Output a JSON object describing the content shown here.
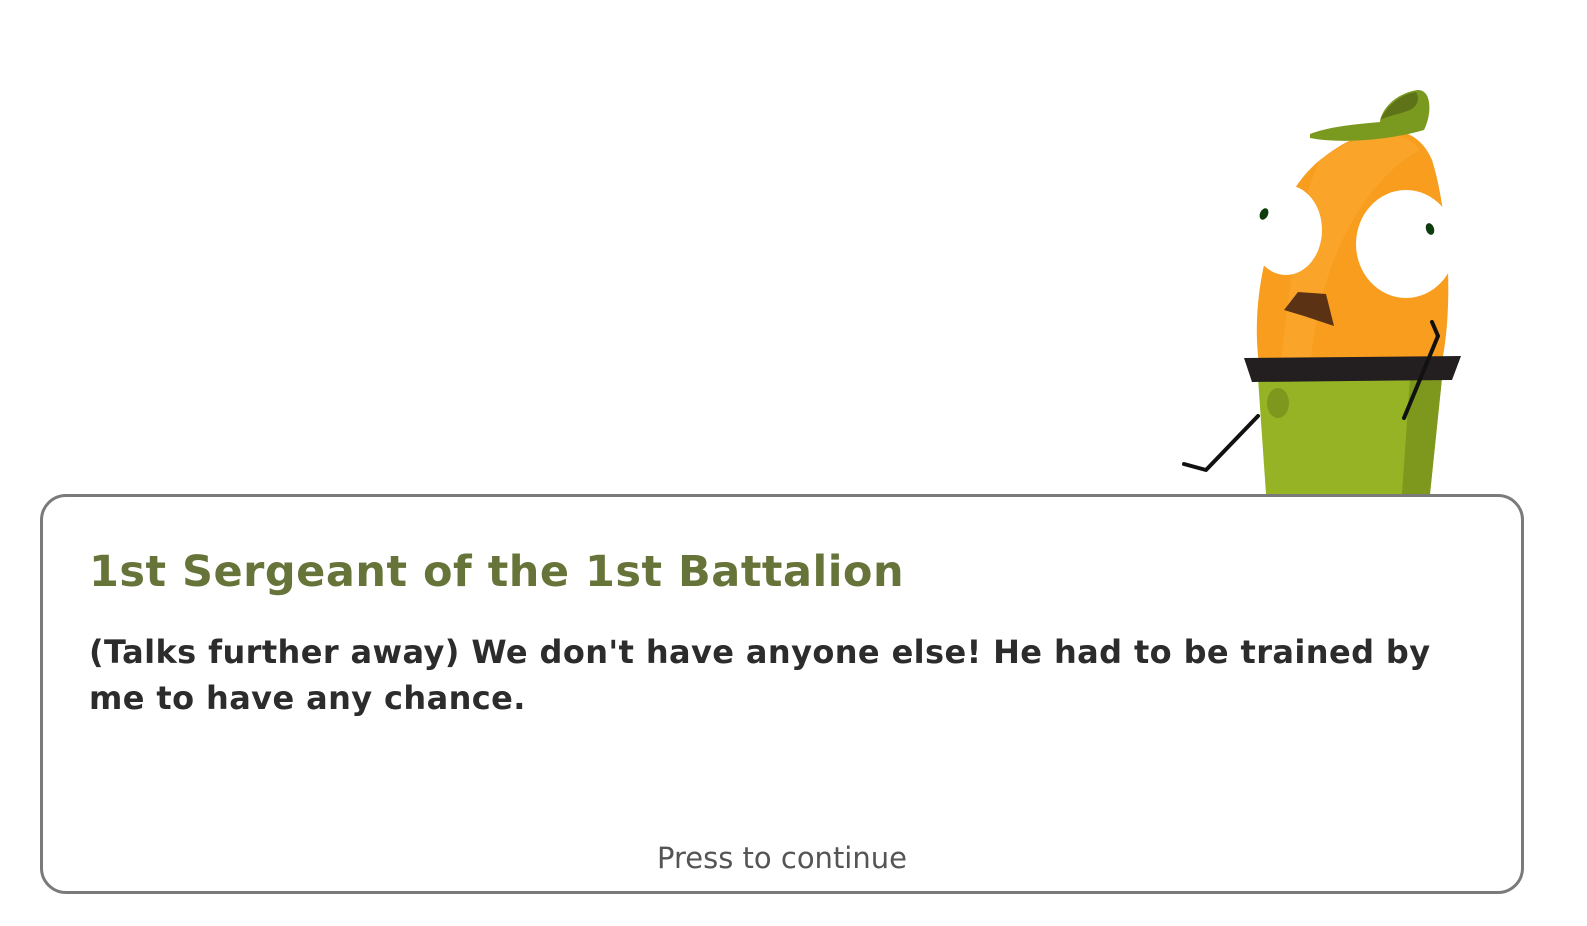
{
  "dialog": {
    "speaker": "1st Sergeant of the 1st Battalion",
    "line": "(Talks further away) We don't have anyone else! He had to be trained by me to have any chance.",
    "continue_prompt": "Press to continue"
  },
  "character": {
    "description": "carrot-sergeant-character",
    "colors": {
      "body_orange": "#f89d1e",
      "pants_green": "#95b325",
      "cap_green": "#7a9a1f",
      "belt": "#231f20",
      "nose": "#5b3213"
    }
  },
  "colors": {
    "speaker_text": "#667339",
    "dialog_text": "#2c2c2c",
    "prompt_text": "#555555",
    "dialog_border": "#7a7a7a"
  }
}
